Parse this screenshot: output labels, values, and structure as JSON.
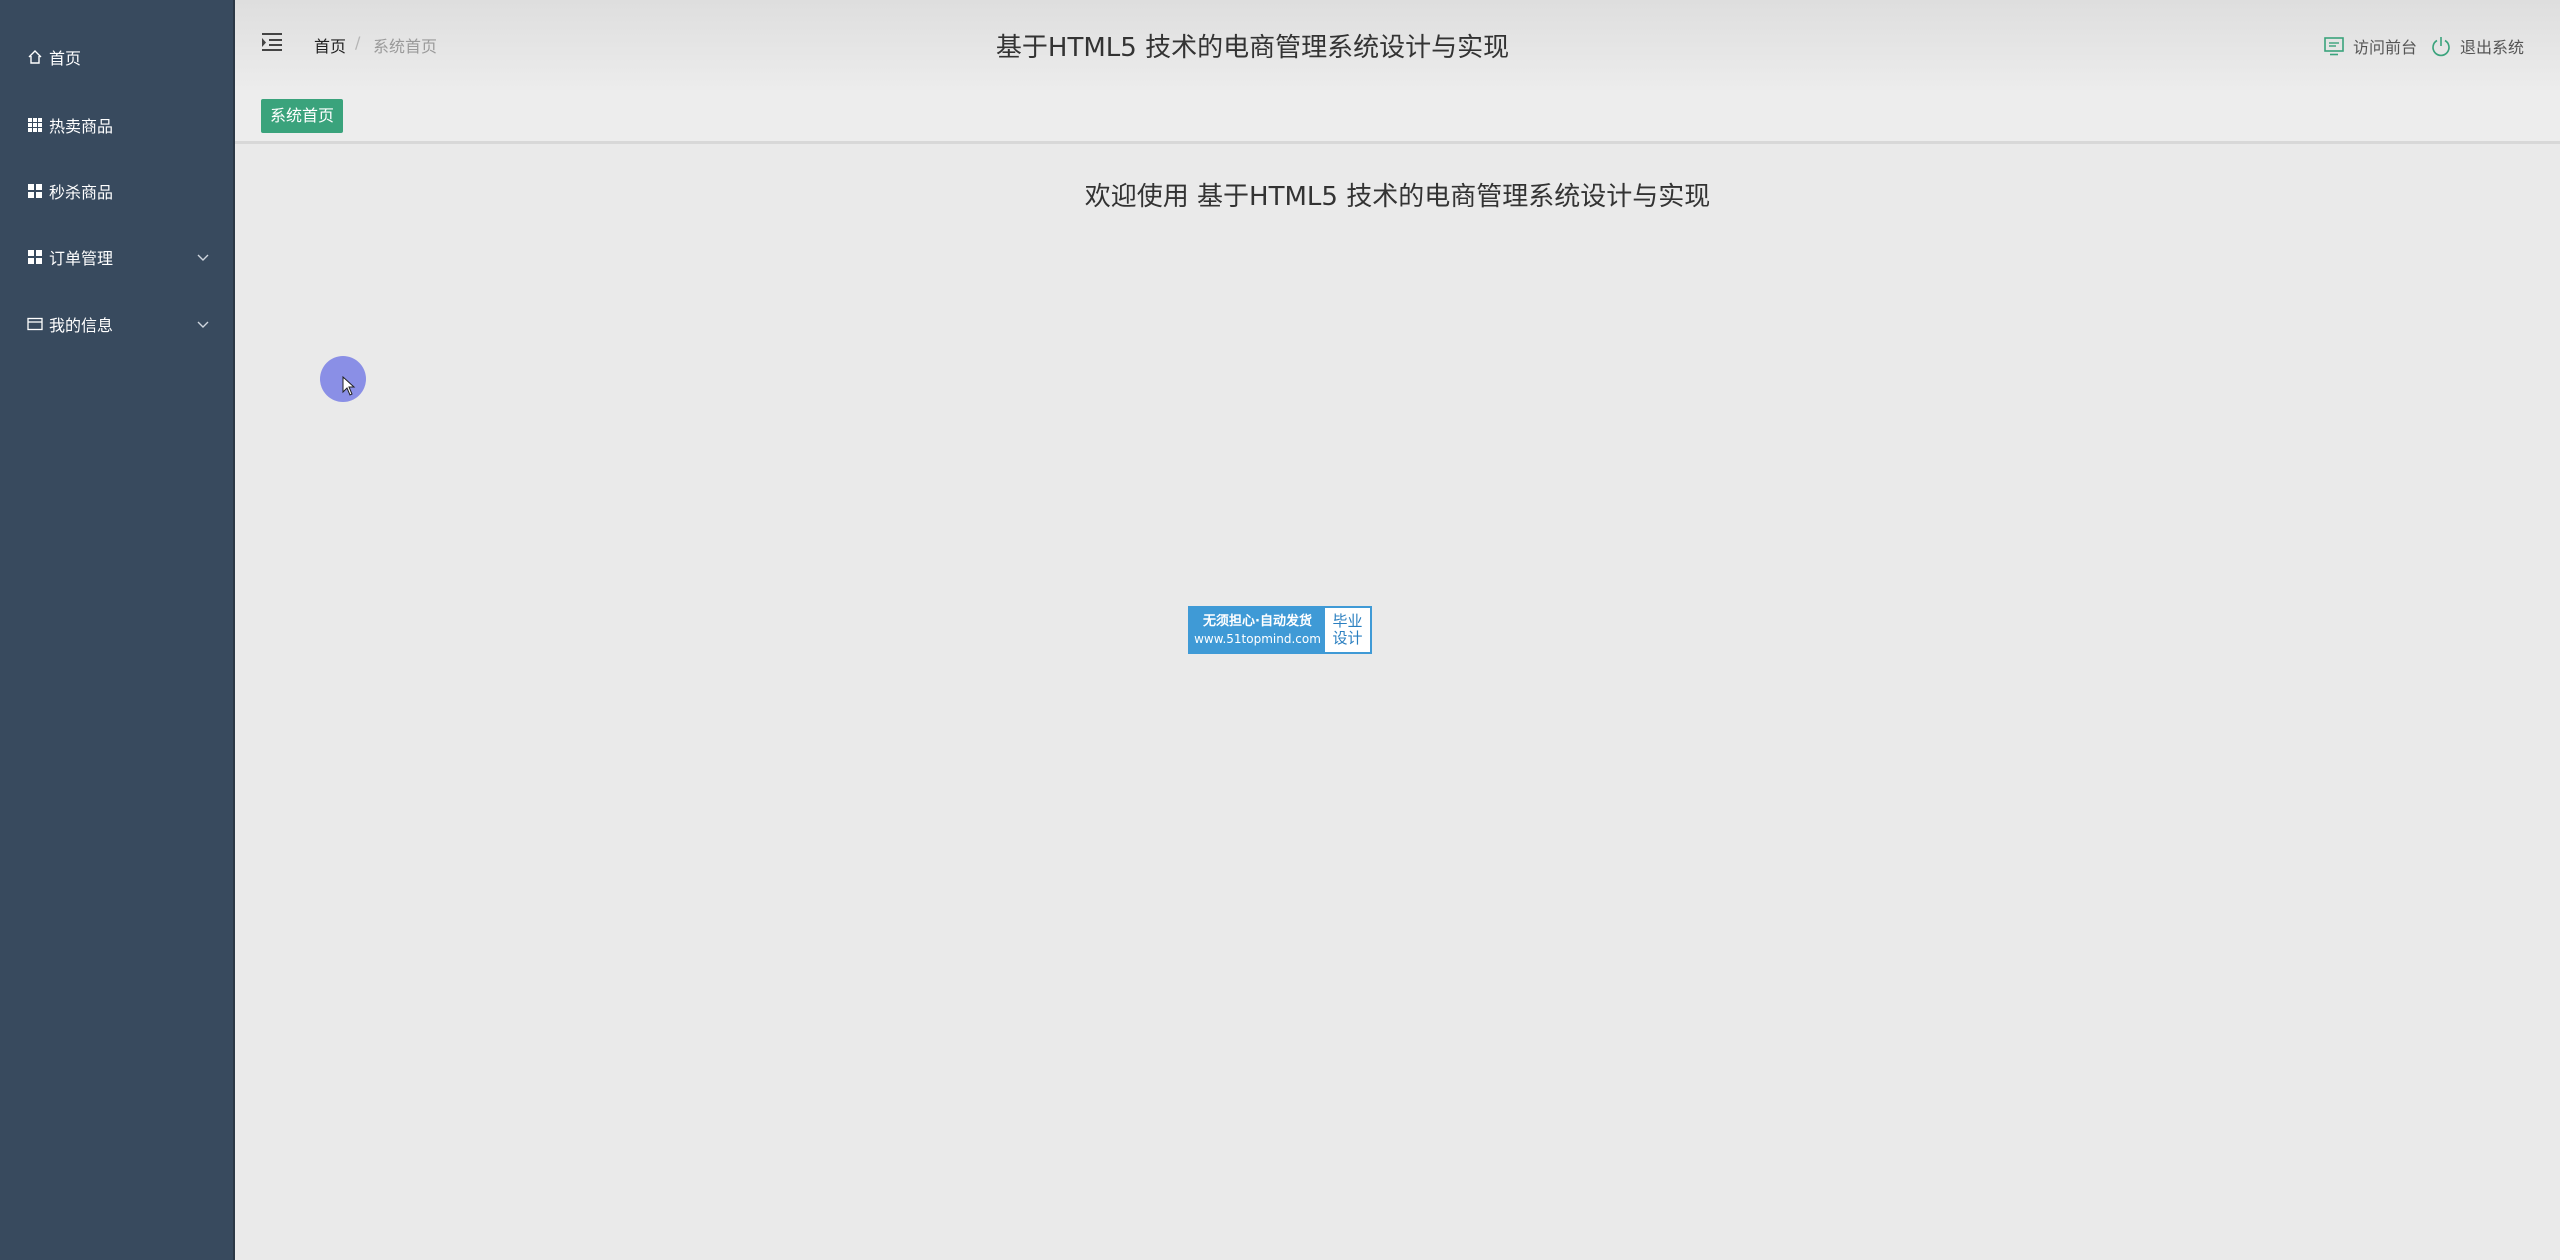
{
  "sidebar": {
    "items": [
      {
        "label": "首页",
        "icon": "home-icon"
      },
      {
        "label": "热卖商品",
        "icon": "grid-icon"
      },
      {
        "label": "秒杀商品",
        "icon": "apps-icon"
      },
      {
        "label": "订单管理",
        "icon": "apps-icon"
      },
      {
        "label": "我的信息",
        "icon": "id-card-icon"
      }
    ]
  },
  "header": {
    "breadcrumb_home": "首页",
    "breadcrumb_sep": "/",
    "breadcrumb_current": "系统首页",
    "title": "基于HTML5 技术的电商管理系统设计与实现",
    "visit_front": "访问前台",
    "logout": "退出系统"
  },
  "tabs": {
    "active": "系统首页"
  },
  "main": {
    "welcome": "欢迎使用 基于HTML5 技术的电商管理系统设计与实现"
  },
  "watermark": {
    "line1": "无须担心·自动发货",
    "line2": "www.51topmind.com",
    "right_line1": "毕业",
    "right_line2": "设计"
  },
  "colors": {
    "sidebar_bg": "#384a5e",
    "accent_green": "#3aa37c",
    "page_bg": "#eaeaea"
  }
}
